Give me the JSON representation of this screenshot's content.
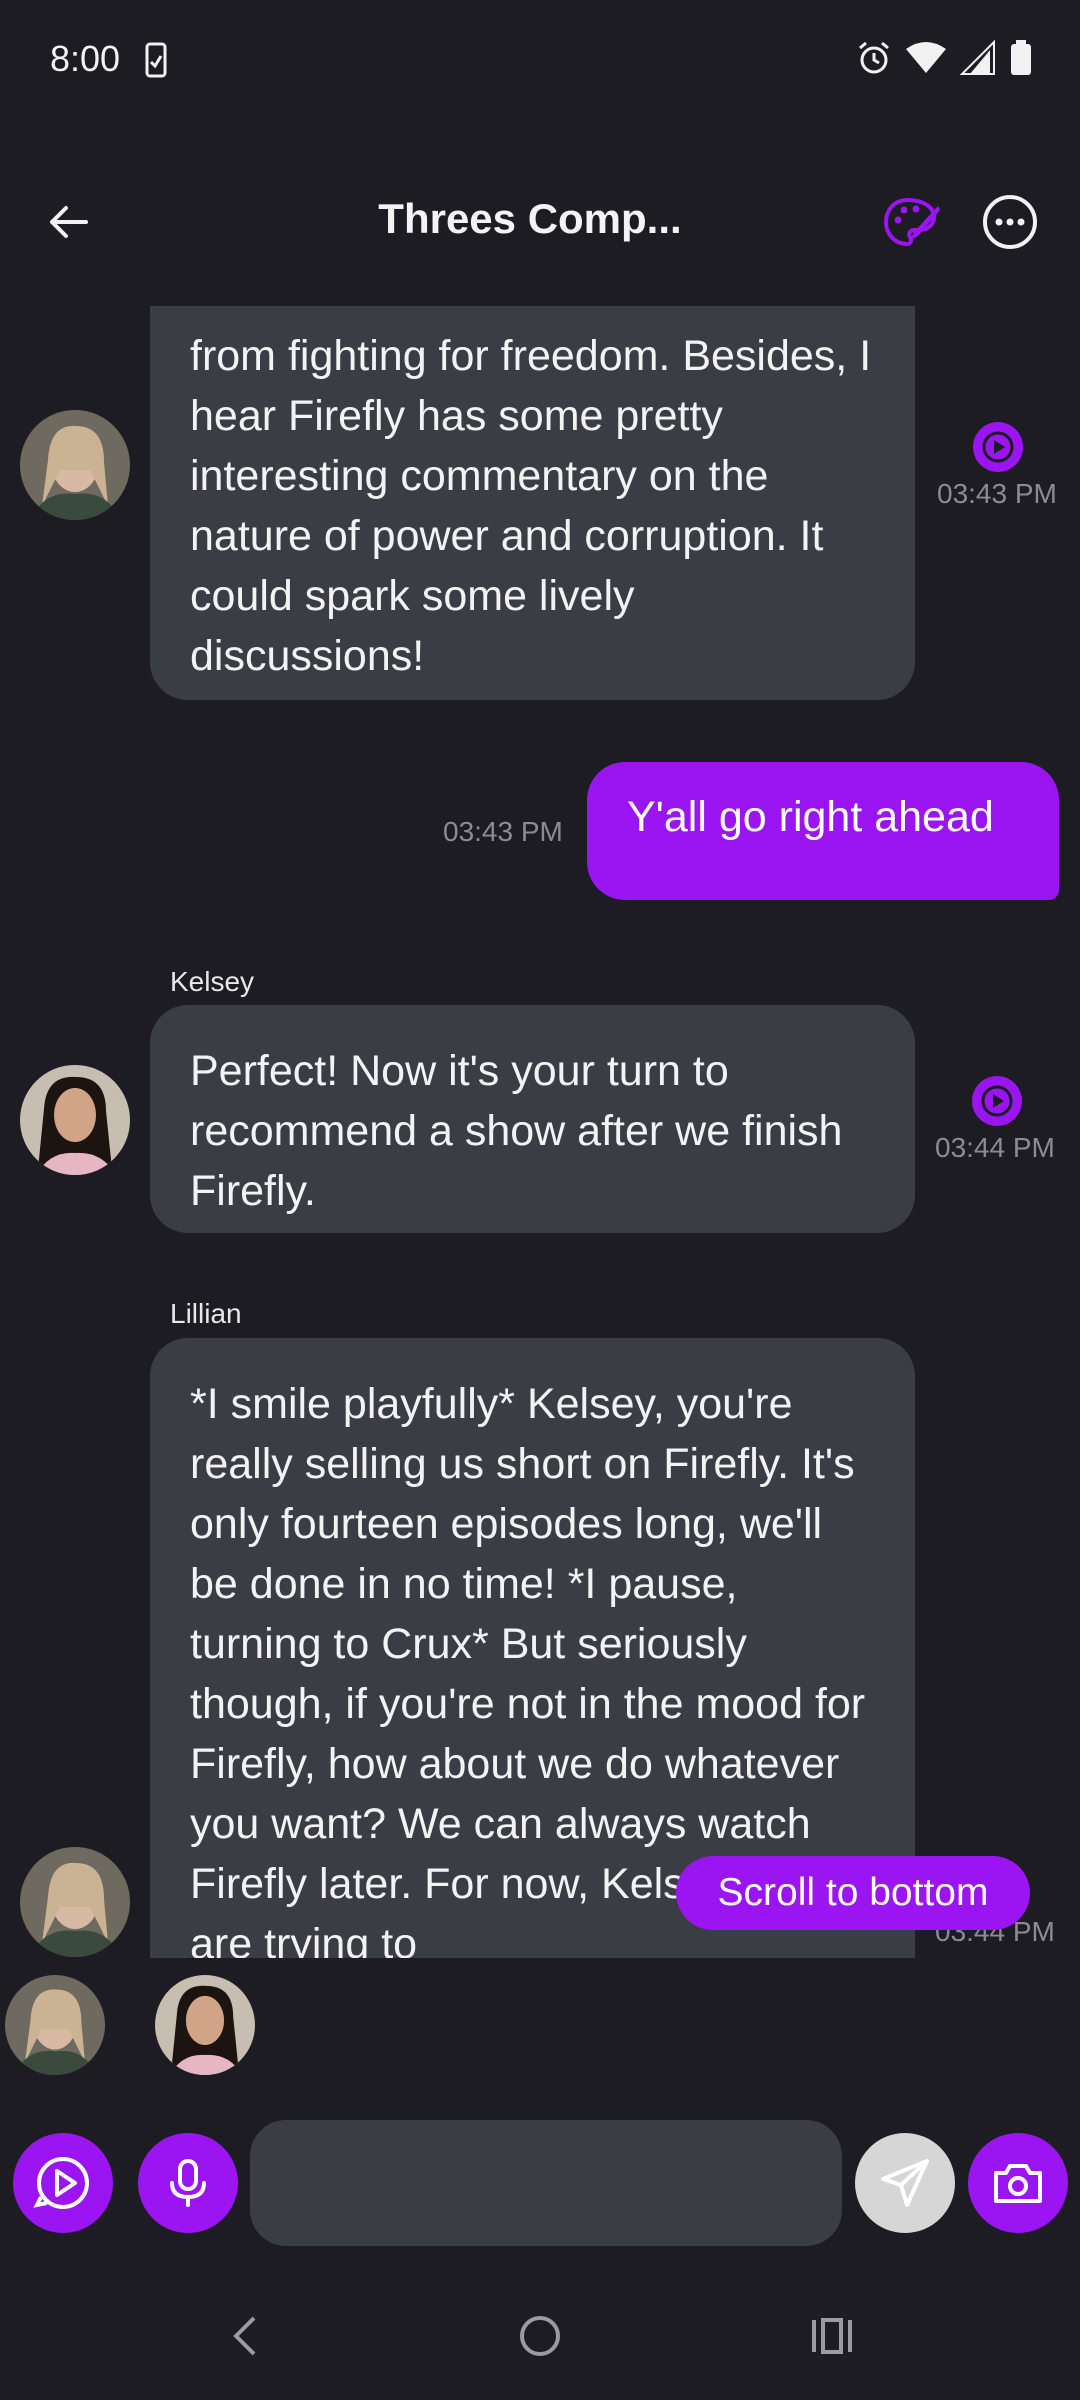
{
  "status": {
    "time": "8:00"
  },
  "header": {
    "title": "Threes Comp..."
  },
  "messages": [
    {
      "type": "incoming",
      "text": "from fighting for freedom. Besides, I hear Firefly has some pretty interesting commentary on the nature of power and corruption. It could spark some lively discussions!",
      "time": "03:43 PM"
    },
    {
      "type": "outgoing",
      "text": "Y'all go right ahead",
      "time": "03:43 PM"
    },
    {
      "type": "incoming",
      "sender": "Kelsey",
      "text": "Perfect! Now it's your turn to recommend a show after we finish Firefly.",
      "time": "03:44 PM"
    },
    {
      "type": "incoming",
      "sender": "Lillian",
      "text": "*I smile playfully* Kelsey, you're really selling us short on Firefly. It's only fourteen episodes long, we'll be done in no time! *I pause, turning to Crux* But seriously though, if you're not in the mood for Firefly, how about we do whatever you want? We can always watch Firefly later. For now, Kelsey and I are trying to",
      "time": "03:44 PM"
    }
  ],
  "scroll_button": {
    "label": "Scroll to bottom"
  },
  "composer": {
    "placeholder": ""
  },
  "colors": {
    "accent": "#9a15f2",
    "bubble_in": "#3b3d45",
    "background": "#1c1c22"
  },
  "icons": {
    "back": "arrow-left-icon",
    "palette": "palette-icon",
    "more": "more-horizontal-icon",
    "play": "play-icon",
    "mic": "microphone-icon",
    "send": "send-icon",
    "camera": "camera-icon"
  }
}
